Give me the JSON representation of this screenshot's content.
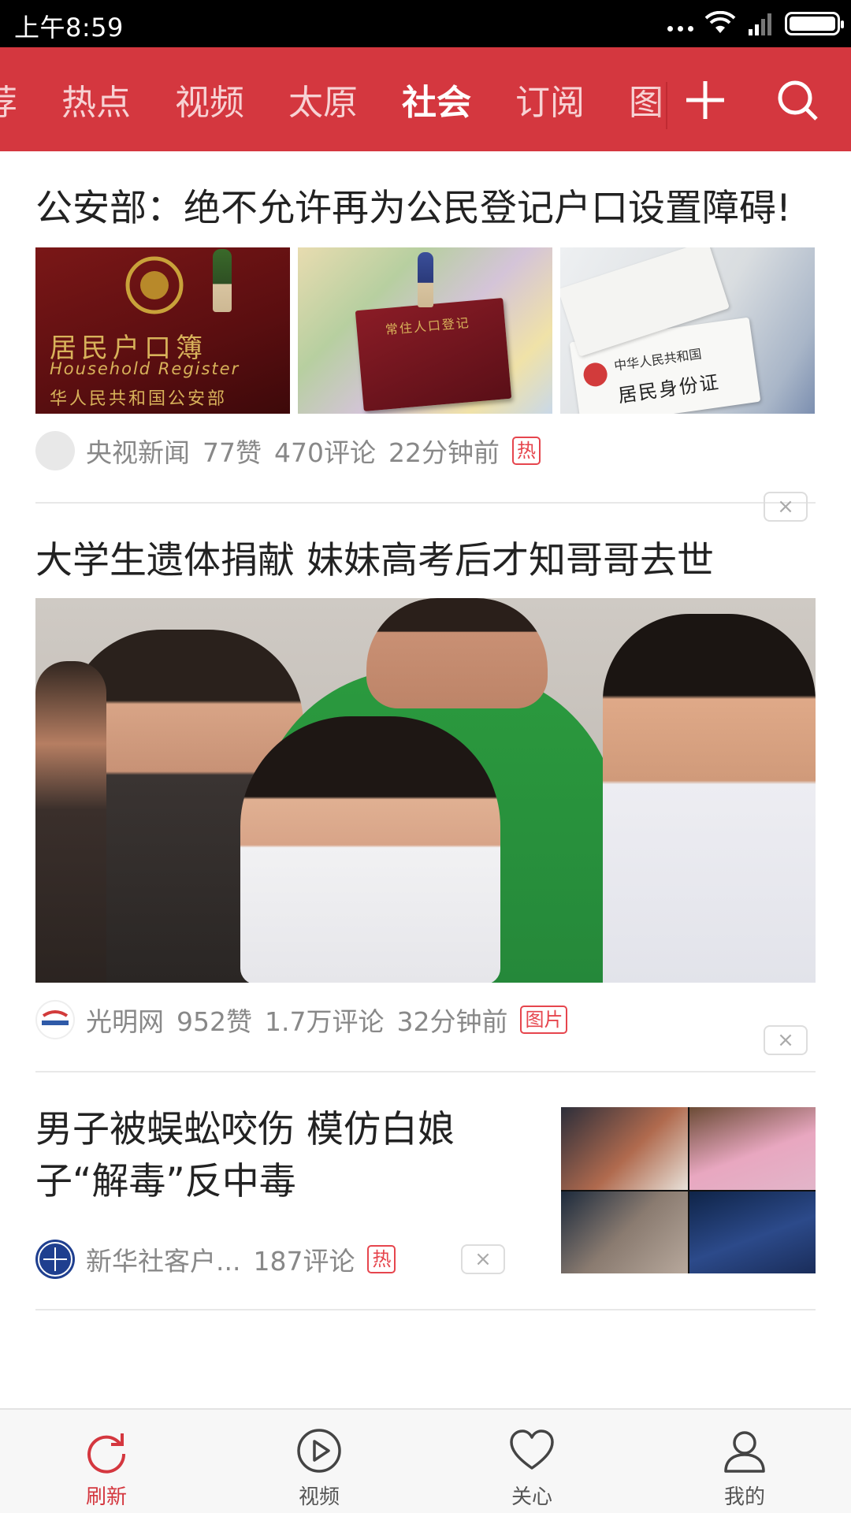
{
  "status_bar": {
    "time": "上午8:59"
  },
  "channels": {
    "tabs": [
      {
        "label": "荐"
      },
      {
        "label": "热点"
      },
      {
        "label": "视频"
      },
      {
        "label": "太原"
      },
      {
        "label": "社会",
        "active": true
      },
      {
        "label": "订阅"
      },
      {
        "label": "图"
      }
    ],
    "add_icon": "plus-icon",
    "search_icon": "search-icon"
  },
  "articles": [
    {
      "title": "公安部：绝不允许再为公民登记户口设置障碍!",
      "image_captions": [
        "居民户口簿",
        "Household Register",
        "华人民共和国公安部",
        "常住人口登记",
        "中华人民共和国",
        "居民身份证"
      ],
      "source": "央视新闻",
      "likes": "77赞",
      "comments": "470评论",
      "time": "22分钟前",
      "tag": "热"
    },
    {
      "title": "大学生遗体捐献 妹妹高考后才知哥哥去世",
      "source": "光明网",
      "likes": "952赞",
      "comments": "1.7万评论",
      "time": "32分钟前",
      "tag": "图片"
    },
    {
      "title": "男子被蜈蚣咬伤 模仿白娘子“解毒”反中毒",
      "source": "新华社客户...",
      "comments": "187评论",
      "tag": "热"
    }
  ],
  "dismiss_label": "×",
  "bottom_nav": [
    {
      "label": "刷新",
      "icon": "refresh-icon",
      "active": true
    },
    {
      "label": "视频",
      "icon": "play-icon"
    },
    {
      "label": "关心",
      "icon": "heart-icon"
    },
    {
      "label": "我的",
      "icon": "user-icon"
    }
  ],
  "colors": {
    "brand_red": "#d4373f",
    "tag_red": "#e6454d",
    "meta_gray": "#888888"
  }
}
